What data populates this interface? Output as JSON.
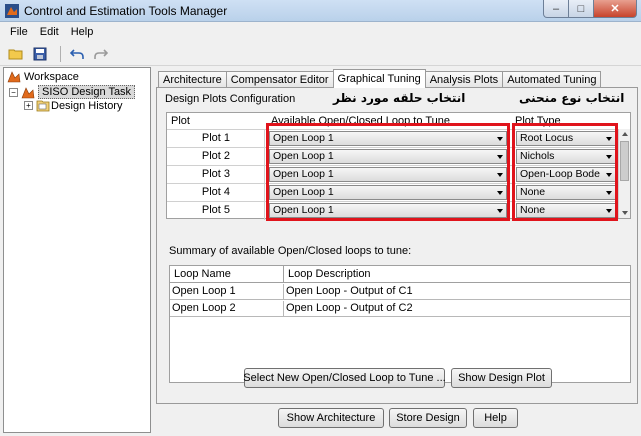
{
  "window": {
    "title": "Control and Estimation Tools Manager"
  },
  "menu": [
    "File",
    "Edit",
    "Help"
  ],
  "tree": {
    "root": "Workspace",
    "task": "SISO Design Task",
    "child": "History",
    "child_prefix": "Design"
  },
  "tabs": [
    "Architecture",
    "Compensator Editor",
    "Graphical Tuning",
    "Analysis Plots",
    "Automated Tuning"
  ],
  "config": {
    "group_label": "Design Plots Configuration",
    "annotation_loop": "انتخاب حلقه مورد نظر",
    "annotation_type": "انتخاب نوع منحنی",
    "headers": {
      "plot": "Plot",
      "loop": "Available Open/Closed Loop to Tune",
      "type": "Plot Type"
    },
    "rows": [
      {
        "plot": "Plot 1",
        "loop": "Open Loop 1",
        "type": "Root Locus"
      },
      {
        "plot": "Plot 2",
        "loop": "Open Loop 1",
        "type": "Nichols"
      },
      {
        "plot": "Plot 3",
        "loop": "Open Loop 1",
        "type": "Open-Loop Bode"
      },
      {
        "plot": "Plot 4",
        "loop": "Open Loop 1",
        "type": "None"
      },
      {
        "plot": "Plot 5",
        "loop": "Open Loop 1",
        "type": "None"
      }
    ]
  },
  "summary": {
    "label": "Summary of available Open/Closed loops to tune:",
    "headers": {
      "name": "Loop Name",
      "desc": "Loop Description"
    },
    "rows": [
      {
        "name": "Open Loop 1",
        "desc": "Open Loop - Output of C1"
      },
      {
        "name": "Open Loop 2",
        "desc": "Open Loop - Output of C2"
      }
    ]
  },
  "buttons": {
    "select_loop": "Select New Open/Closed Loop to Tune ...",
    "show_plot": "Show Design Plot",
    "show_arch": "Show Architecture",
    "store": "Store Design",
    "help": "Help"
  },
  "colors": {
    "highlight": "#e0141c"
  }
}
